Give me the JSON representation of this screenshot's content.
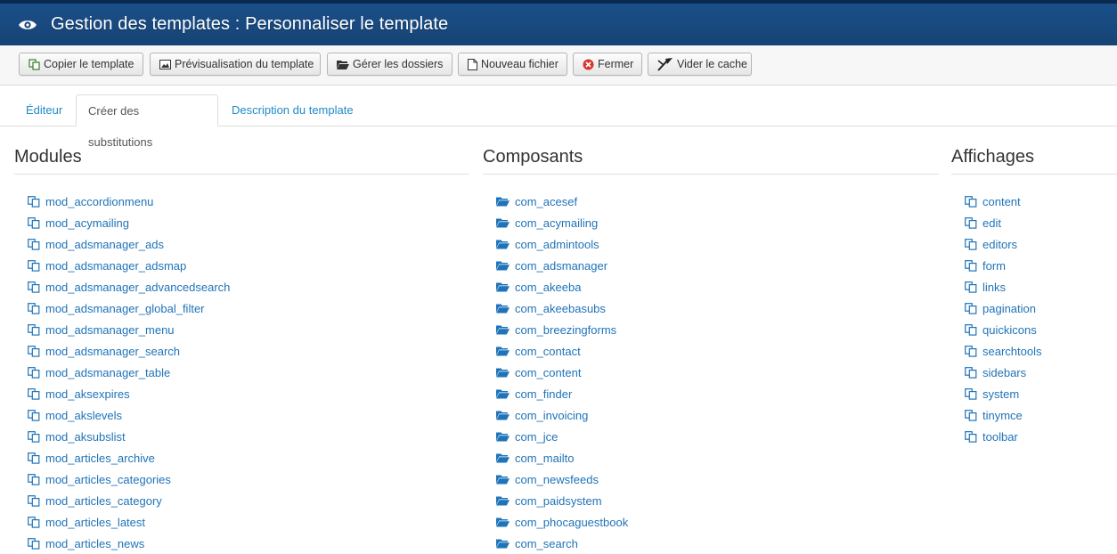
{
  "header": {
    "title": "Gestion des templates : Personnaliser le template",
    "icon": "eye-icon"
  },
  "toolbar": {
    "copy": "Copier le template",
    "preview": "Prévisualisation du template",
    "folders": "Gérer les dossiers",
    "newfile": "Nouveau fichier",
    "close": "Fermer",
    "cache": "Vider le cache"
  },
  "tabs": [
    "Éditeur",
    "Créer des substitutions",
    "Description du template"
  ],
  "active_tab": "Créer des substitutions",
  "columns": {
    "modules": {
      "title": "Modules",
      "items": [
        "mod_accordionmenu",
        "mod_acymailing",
        "mod_adsmanager_ads",
        "mod_adsmanager_adsmap",
        "mod_adsmanager_advancedsearch",
        "mod_adsmanager_global_filter",
        "mod_adsmanager_menu",
        "mod_adsmanager_search",
        "mod_adsmanager_table",
        "mod_aksexpires",
        "mod_akslevels",
        "mod_aksubslist",
        "mod_articles_archive",
        "mod_articles_categories",
        "mod_articles_category",
        "mod_articles_latest",
        "mod_articles_news"
      ]
    },
    "components": {
      "title": "Composants",
      "items": [
        "com_acesef",
        "com_acymailing",
        "com_admintools",
        "com_adsmanager",
        "com_akeeba",
        "com_akeebasubs",
        "com_breezingforms",
        "com_contact",
        "com_content",
        "com_finder",
        "com_invoicing",
        "com_jce",
        "com_mailto",
        "com_newsfeeds",
        "com_paidsystem",
        "com_phocaguestbook",
        "com_search"
      ]
    },
    "layouts": {
      "title": "Affichages",
      "items": [
        "content",
        "edit",
        "editors",
        "form",
        "links",
        "pagination",
        "quickicons",
        "searchtools",
        "sidebars",
        "system",
        "tinymce",
        "toolbar"
      ]
    }
  },
  "colors": {
    "header": "#164374",
    "link": "#1f73b8",
    "tab_link": "#1f8ac9"
  }
}
